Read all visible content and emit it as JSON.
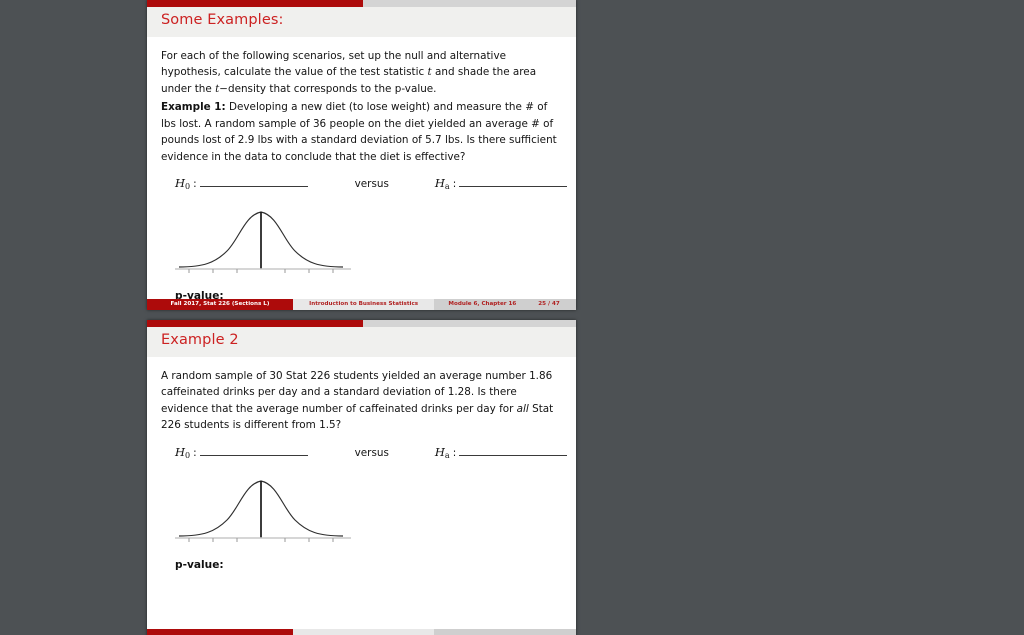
{
  "viewer": {
    "background_color": "#4d5154",
    "accent_color": "#ad0b0b",
    "title_color": "#cc2222"
  },
  "slides": [
    {
      "id": "slide-1",
      "title": "Some Examples:",
      "progress_percent": 50,
      "paragraphs": [
        {
          "id": "intro",
          "runs": [
            {
              "text": "For each of the following scenarios, set up the null and alternative hypothesis, calculate the value of the test statistic ",
              "style": "normal"
            },
            {
              "text": "t",
              "style": "mathit"
            },
            {
              "text": " and shade the area under the ",
              "style": "normal"
            },
            {
              "text": "t",
              "style": "mathit"
            },
            {
              "text": "−density that corresponds to the p-value.",
              "style": "normal"
            }
          ]
        },
        {
          "id": "example-1",
          "runs": [
            {
              "text": "Example 1:",
              "style": "bold"
            },
            {
              "text": " Developing a new diet (to lose weight) and measure the # of lbs lost. A random sample of 36 people on the diet yielded an average # of pounds lost of 2.9 lbs with a standard deviation of 5.7 lbs. Is there sufficient evidence in the data to conclude that the diet is effective?",
              "style": "normal"
            }
          ]
        }
      ],
      "hypothesis": {
        "null_symbol": "H",
        "null_subscript": "0",
        "alt_symbol": "H",
        "alt_subscript": "a",
        "colon": ":",
        "versus_label": "versus"
      },
      "pvalue_label": "p-value:",
      "plot": {
        "name": "t-density-curve",
        "description": "bell-shaped t-density curve with vertical center line and axis tick marks"
      },
      "footer": {
        "left": "Fall 2017, Stat 226  (Sections L)",
        "middle": "Introduction to Business Statistics",
        "right_chapter": "Module 6, Chapter 16",
        "right_page": "25 / 47"
      }
    },
    {
      "id": "slide-2",
      "title": "Example 2",
      "progress_percent": 50,
      "paragraphs": [
        {
          "id": "example-2",
          "runs": [
            {
              "text": "A random sample of 30 Stat 226 students yielded an average number 1.86 caffeinated drinks per day and a standard deviation of 1.28. Is there evidence that the average number of caffeinated drinks per day for ",
              "style": "normal"
            },
            {
              "text": "all",
              "style": "italic"
            },
            {
              "text": " Stat 226 students is different from 1.5?",
              "style": "normal"
            }
          ]
        }
      ],
      "hypothesis": {
        "null_symbol": "H",
        "null_subscript": "0",
        "alt_symbol": "H",
        "alt_subscript": "a",
        "colon": ":",
        "versus_label": "versus"
      },
      "pvalue_label": "p-value:",
      "plot": {
        "name": "t-density-curve",
        "description": "bell-shaped t-density curve with vertical center line and axis tick marks"
      }
    }
  ]
}
